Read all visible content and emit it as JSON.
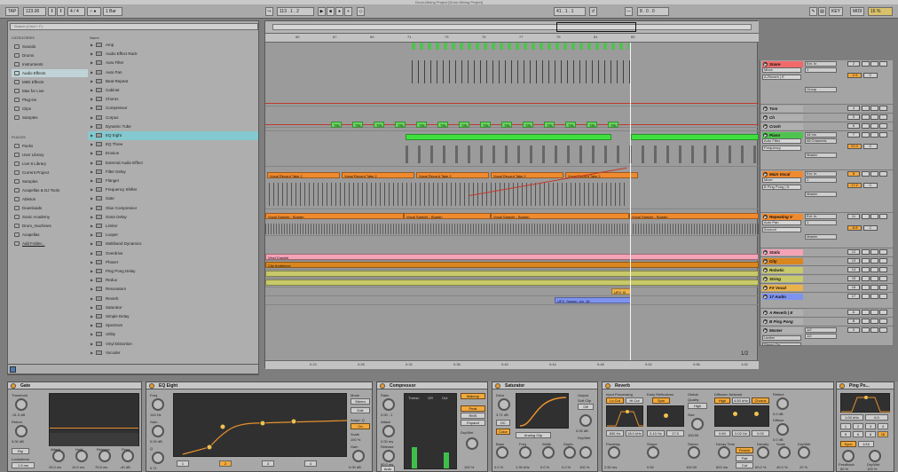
{
  "window": {
    "title": "Drum-Mixing Project [Drum-Mixing Project]"
  },
  "transport": {
    "tap": "TAP",
    "tempo": "123.00",
    "sig": "4 / 4",
    "metro": "○ ●",
    "quant": "1 Bar",
    "arr_pos": "113 .   1 .   2",
    "loop_start": "41 .   1 .   1",
    "loop_len": "8 .   0 .   0",
    "key": "KEY",
    "midi": "MIDI",
    "cpu": "16 %"
  },
  "browser": {
    "search_placeholder": "Search (Cmd + F)",
    "categories_header": "CATEGORIES",
    "name_header": "Name",
    "places_header": "PLACES",
    "categories": [
      "Sounds",
      "Drums",
      "Instruments",
      "Audio Effects",
      "MIDI Effects",
      "Max for Live",
      "Plug-ins",
      "Clips",
      "Samples"
    ],
    "places": [
      "Packs",
      "User Library",
      "Live 8 Library",
      "Current Project",
      "Samples",
      "Acapellas & DJ Tools",
      "Ableton",
      "Downloads",
      "Sonic Academy",
      "Drum_machines",
      "Acapellas",
      "Add Folder..."
    ],
    "items": [
      "Amp",
      "Audio Effect Rack",
      "Auto Filter",
      "Auto Pan",
      "Beat Repeat",
      "Cabinet",
      "Chorus",
      "Compressor",
      "Corpus",
      "Dynamic Tube",
      "EQ Eight",
      "EQ Three",
      "Erosion",
      "External Audio Effect",
      "Filter Delay",
      "Flanger",
      "Frequency Shifter",
      "Gate",
      "Glue Compressor",
      "Grain Delay",
      "Limiter",
      "Looper",
      "Multiband Dynamics",
      "Overdrive",
      "Phaser",
      "Ping Pong Delay",
      "Redux",
      "Resonators",
      "Reverb",
      "Saturator",
      "Simple Delay",
      "Spectrum",
      "Utility",
      "Vinyl Distortion",
      "Vocoder"
    ],
    "selected_item": "EQ Eight"
  },
  "arrangement": {
    "ruler": [
      "65",
      "67",
      "69",
      "71",
      "73",
      "75",
      "77",
      "79",
      "81",
      "83"
    ],
    "timeline": [
      "0:24",
      "0:28",
      "0:32",
      "0:36",
      "0:40",
      "0:44",
      "0:48",
      "0:52",
      "0:56",
      "1:00"
    ],
    "page": "1/2",
    "clips": {
      "vocal_take": "Vocal Record Take 2",
      "vocal_sample": "Vocal Sample - Buggin",
      "vinyl": "Vinyl Crackle",
      "city": "City Ambience",
      "ufx_b": "UFX_B",
      "ufx_sweep": "UFX_Sweep_Up_16",
      "trl": "TRL"
    }
  },
  "mixer": {
    "tracks": [
      {
        "name": "Snare",
        "num": "2",
        "io": "Ext. In",
        "io2": "1",
        "color": "#f06a6a"
      },
      {
        "name": "Tom",
        "num": "4",
        "color": "#b0b0b0"
      },
      {
        "name": "Ch",
        "num": "5",
        "color": "#b0b0b0"
      },
      {
        "name": "Crash",
        "num": "6",
        "color": "#b0b0b0"
      },
      {
        "name": "Piano",
        "num": "7",
        "io": "All Ins",
        "io2": "All Channels",
        "color": "#4fc34f"
      },
      {
        "name": "Main Vocal",
        "num": "8",
        "io": "Ext. In",
        "io2": "1",
        "color": "#f08a2e"
      },
      {
        "name": "Repeating V",
        "num": "11",
        "io": "Ext. In",
        "io2": "1",
        "color": "#f08a2e"
      },
      {
        "name": "Static",
        "num": "12",
        "color": "#f4a3b6"
      },
      {
        "name": "City",
        "num": "13",
        "color": "#d9861f"
      },
      {
        "name": "Robotic",
        "num": "14",
        "color": "#c7c96a"
      },
      {
        "name": "String",
        "num": "15",
        "color": "#c7c96a"
      },
      {
        "name": "FX Vocal",
        "num": "16",
        "color": "#eab24a"
      },
      {
        "name": "17 Audio",
        "num": "17",
        "color": "#7e93f0"
      },
      {
        "name": "A Reverb | E",
        "num": "A",
        "color": "#b0b0b0"
      },
      {
        "name": "B Ping Pong",
        "num": "B",
        "color": "#b0b0b0"
      },
      {
        "name": "Master",
        "num": "0",
        "io": "1/2",
        "io2": "1/2",
        "color": "#b0b0b0"
      }
    ],
    "snare_sends": [
      "Mbox",
      "A-Reverb | E"
    ],
    "snare_vals": [
      "-2.5",
      "C"
    ],
    "piano_params": [
      "Auto Filter",
      "Frequency"
    ],
    "piano_vals": [
      "22.0",
      "C"
    ],
    "vocal_params": [
      "Mixer",
      "B Ping Pong | N"
    ],
    "vocal_vals": [
      "17.2",
      "C"
    ],
    "repeat_params": [
      "Auto Pan",
      "Amount"
    ],
    "repeat_vals": [
      "-5.8",
      "C"
    ],
    "group_label": "Group",
    "master_label": "Master",
    "auto": "Auto",
    "off": "Off",
    "in_label": "In",
    "limiter": "Limiter",
    "gain": "Gain",
    "stereo": "Stereo On"
  },
  "devices": {
    "gate": {
      "title": "Gate",
      "threshold": "Threshold",
      "threshold_val": "-31.0 dB",
      "return": "Return",
      "return_val": "3.00 dB",
      "flip": "Flip",
      "lookahead": "Lookahead",
      "look_val": "1.5 ms",
      "attack": "Attack",
      "hold": "Hold",
      "release": "Release",
      "floor": "Floor",
      "attack_val": "25.0 ms",
      "hold_val": "10.0 ms",
      "release_val": "75.5 ms",
      "floor_val": "-40 dB"
    },
    "eq": {
      "title": "EQ Eight",
      "freq": "Freq",
      "freq_val": "144 Hz",
      "gain": "Gain",
      "gain_val": "0.00 dB",
      "q": "Q",
      "q_val": "0.71",
      "mode": "Mode",
      "mode_val": "Stereo",
      "edit": "Edit",
      "adapt": "Adapt. Q",
      "on": "On",
      "scale": "Scale",
      "scale_val": "100 %",
      "gain2": "Gain",
      "gain2_val": "0.00 dB",
      "bands": [
        "1",
        "2",
        "3",
        "4"
      ]
    },
    "comp": {
      "title": "Compressor",
      "ratio": "Ratio",
      "ratio_val": "2.00 : 1",
      "attack": "Attack",
      "attack_val": "2.00 ms",
      "release": "Release",
      "release_val": "90.0 ms",
      "auto": "Auto",
      "thresh": "Thresh",
      "gr": "GR",
      "out": "Out",
      "makeup": "Makeup",
      "peak": "Peak",
      "rms": "RMS",
      "expand": "Expand",
      "drywet": "Dry/Wet",
      "dw_val": "100 %",
      "out_val": "0.00 dB"
    },
    "sat": {
      "title": "Saturator",
      "drive": "Drive",
      "drive_val": "3.71 dB",
      "dc": "DC",
      "color": "Color",
      "type": "Analog Clip",
      "base": "Base",
      "freq": "Freq",
      "width": "Width",
      "depth": "Depth",
      "base_val": "0.0 %",
      "freq_val": "1.30 kHz",
      "width_val": "0.0 %",
      "depth_val": "0.0 %",
      "output": "Output",
      "output_val": "0.00 dB",
      "softclip": "Soft Clip",
      "off": "Off",
      "drywet": "Dry/Wet",
      "dw_val": "100 %"
    },
    "reverb": {
      "title": "Reverb",
      "input": "Input Processing",
      "lo": "Lo Cut",
      "hi": "Hi Cut",
      "early": "Early Reflections",
      "spin": "Spin",
      "global": "Global",
      "quality": "Quality",
      "quality_val": "High",
      "size": "Size",
      "size_val": "100.00",
      "diffusion": "Diffusion Network",
      "high": "High",
      "chorus": "Chorus",
      "predelay": "Predelay",
      "predelay_val": "2.50 ms",
      "shape": "Shape",
      "shape_val": "0.50",
      "stereo": "Stereo",
      "stereo_val": "100.00",
      "decay": "Decay Time",
      "decay_val": "822 ms",
      "freeze": "Freeze",
      "flat": "Flat",
      "cut": "Cut",
      "density": "Density",
      "density_val": "60.0 %",
      "scale": "Scale",
      "scale_val": "40.0 %",
      "reflect": "Reflect",
      "reflect_val": "0.0 dB",
      "diffuse": "Diffuse",
      "diffuse_val": "0.0 dB",
      "drywet": "Dry/Wet",
      "dw_val": "22 %",
      "f1": "830 Hz",
      "f2": "18.0 kHz",
      "f3": "5.5",
      "f4": "0.10 Hz",
      "f5": "17.5",
      "f6": "4.50 kHz",
      "f7": "0.60",
      "f8": "0.02 Hz",
      "f9": "0.02"
    },
    "ping": {
      "title": "Ping Po...",
      "freq": "1.00 kHz",
      "width": "6.0",
      "beats": [
        "1",
        "2",
        "3",
        "4",
        "5",
        "6",
        "8",
        "16"
      ],
      "sync": "Sync",
      "time": "1/16",
      "feedback": "Feedback",
      "fb_val": "60 %",
      "freeze": "Freeze",
      "drywet": "Dry/Wet",
      "dw_val": "100 %"
    }
  }
}
